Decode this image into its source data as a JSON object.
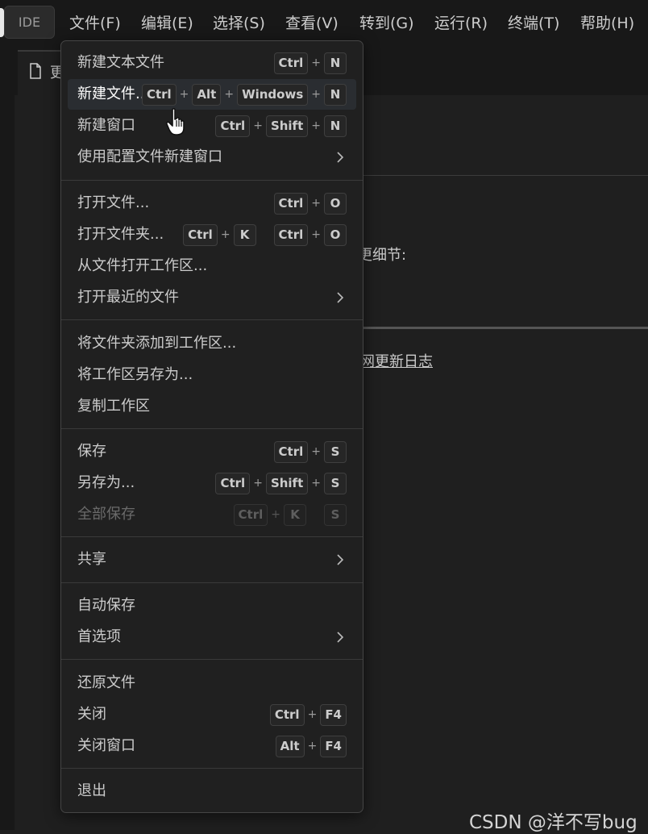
{
  "titlebar": {
    "ide_label": "IDE",
    "menus": [
      "文件(F)",
      "编辑(E)",
      "选择(S)",
      "查看(V)",
      "转到(G)",
      "运行(R)",
      "终端(T)",
      "帮助(H)"
    ]
  },
  "editor": {
    "tab_label": "更",
    "line_detail": "更细节:",
    "line_link": "网更新日志"
  },
  "file_menu": {
    "items": [
      {
        "label": "新建文本文件",
        "keys": [
          "Ctrl",
          "N"
        ]
      },
      {
        "label": "新建文件...",
        "keys": [
          "Ctrl",
          "Alt",
          "Windows",
          "N"
        ]
      },
      {
        "label": "新建窗口",
        "keys": [
          "Ctrl",
          "Shift",
          "N"
        ]
      },
      {
        "label": "使用配置文件新建窗口",
        "submenu": true
      },
      {
        "label": "打开文件...",
        "keys": [
          "Ctrl",
          "O"
        ]
      },
      {
        "label": "打开文件夹...",
        "keys": [
          "Ctrl",
          "K"
        ],
        "keys2": [
          "Ctrl",
          "O"
        ]
      },
      {
        "label": "从文件打开工作区..."
      },
      {
        "label": "打开最近的文件",
        "submenu": true
      },
      {
        "label": "将文件夹添加到工作区..."
      },
      {
        "label": "将工作区另存为..."
      },
      {
        "label": "复制工作区"
      },
      {
        "label": "保存",
        "keys": [
          "Ctrl",
          "S"
        ]
      },
      {
        "label": "另存为...",
        "keys": [
          "Ctrl",
          "Shift",
          "S"
        ]
      },
      {
        "label": "全部保存",
        "keys": [
          "Ctrl",
          "K"
        ],
        "keys2": [
          "S"
        ],
        "disabled": true
      },
      {
        "label": "共享",
        "submenu": true
      },
      {
        "label": "自动保存"
      },
      {
        "label": "首选项",
        "submenu": true
      },
      {
        "label": "还原文件"
      },
      {
        "label": "关闭",
        "keys": [
          "Ctrl",
          "F4"
        ]
      },
      {
        "label": "关闭窗口",
        "keys": [
          "Alt",
          "F4"
        ]
      },
      {
        "label": "退出"
      }
    ]
  },
  "watermark": "CSDN @洋不写bug",
  "colors": {
    "menu_bg": "#202020",
    "menu_hover": "#2a2d31",
    "text": "#cccccc",
    "disabled_text": "#6a6a6a"
  }
}
